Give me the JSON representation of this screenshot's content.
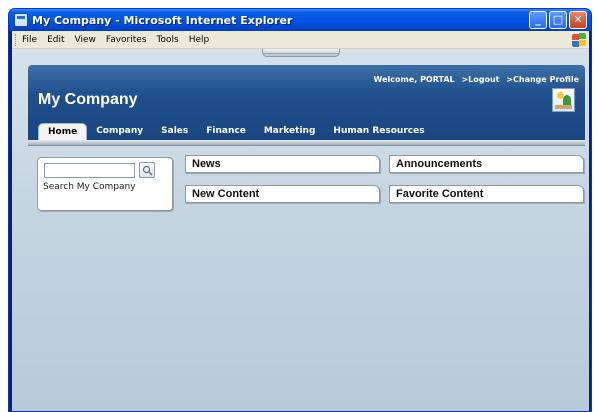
{
  "window": {
    "title": "My Company - Microsoft Internet Explorer",
    "buttons": {
      "minimize": "_",
      "maximize": "□",
      "close": "✕"
    }
  },
  "menubar": {
    "items": [
      "File",
      "Edit",
      "View",
      "Favorites",
      "Tools",
      "Help"
    ]
  },
  "portal": {
    "welcome": "Welcome, PORTAL",
    "logout": ">Logout",
    "change_profile": ">Change Profile",
    "company_name": "My Company",
    "tabs": [
      {
        "label": "Home",
        "active": true
      },
      {
        "label": "Company"
      },
      {
        "label": "Sales"
      },
      {
        "label": "Finance"
      },
      {
        "label": "Marketing"
      },
      {
        "label": "Human Resources"
      }
    ]
  },
  "search": {
    "value": "",
    "label": "Search My Company"
  },
  "portlets": {
    "news": "News",
    "announcements": "Announcements",
    "new_content": "New Content",
    "favorite_content": "Favorite Content"
  },
  "colors": {
    "titlebar": "#0054e3",
    "header": "#1f4f8c",
    "background": "#c6d6e1"
  }
}
